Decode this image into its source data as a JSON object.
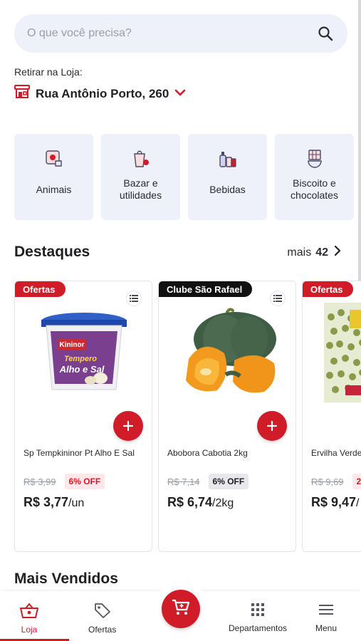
{
  "search": {
    "placeholder": "O que você precisa?",
    "icon": "search-icon"
  },
  "pickup": {
    "label": "Retirar na Loja:",
    "store": "Rua Antônio Porto, 260"
  },
  "categories": [
    {
      "label": "Animais",
      "icon": "pet-icon"
    },
    {
      "label": "Bazar e utilidades",
      "icon": "bazaar-icon"
    },
    {
      "label": "Bebidas",
      "icon": "drinks-icon"
    },
    {
      "label": "Biscoito e chocolates",
      "icon": "cookies-icon"
    }
  ],
  "highlights": {
    "title": "Destaques",
    "more_label": "mais",
    "more_count": "42"
  },
  "products": [
    {
      "badge": "Ofertas",
      "name": "Sp Tempkininor Pt Alho E Sal",
      "old_price": "R$ 3,99",
      "discount": "6% OFF",
      "price": "R$ 3,77",
      "unit": "/un",
      "image_label": "Kininor Tempero Alho e Sal"
    },
    {
      "badge": "Clube São Rafael",
      "name": "Abobora Cabotia 2kg",
      "old_price": "R$ 7,14",
      "discount": "6% OFF",
      "price": "R$ 6,74",
      "unit": "/2kg"
    },
    {
      "badge": "Ofertas",
      "name": "Ervilha Verde",
      "old_price": "R$ 9,69",
      "discount": "2",
      "price": "R$ 9,47",
      "unit": "/"
    }
  ],
  "best_sellers": {
    "title": "Mais Vendidos"
  },
  "nav": {
    "store": "Loja",
    "offers": "Ofertas",
    "departments": "Departamentos",
    "menu": "Menu"
  },
  "colors": {
    "accent": "#d01c28",
    "surface": "#eef0fa"
  }
}
